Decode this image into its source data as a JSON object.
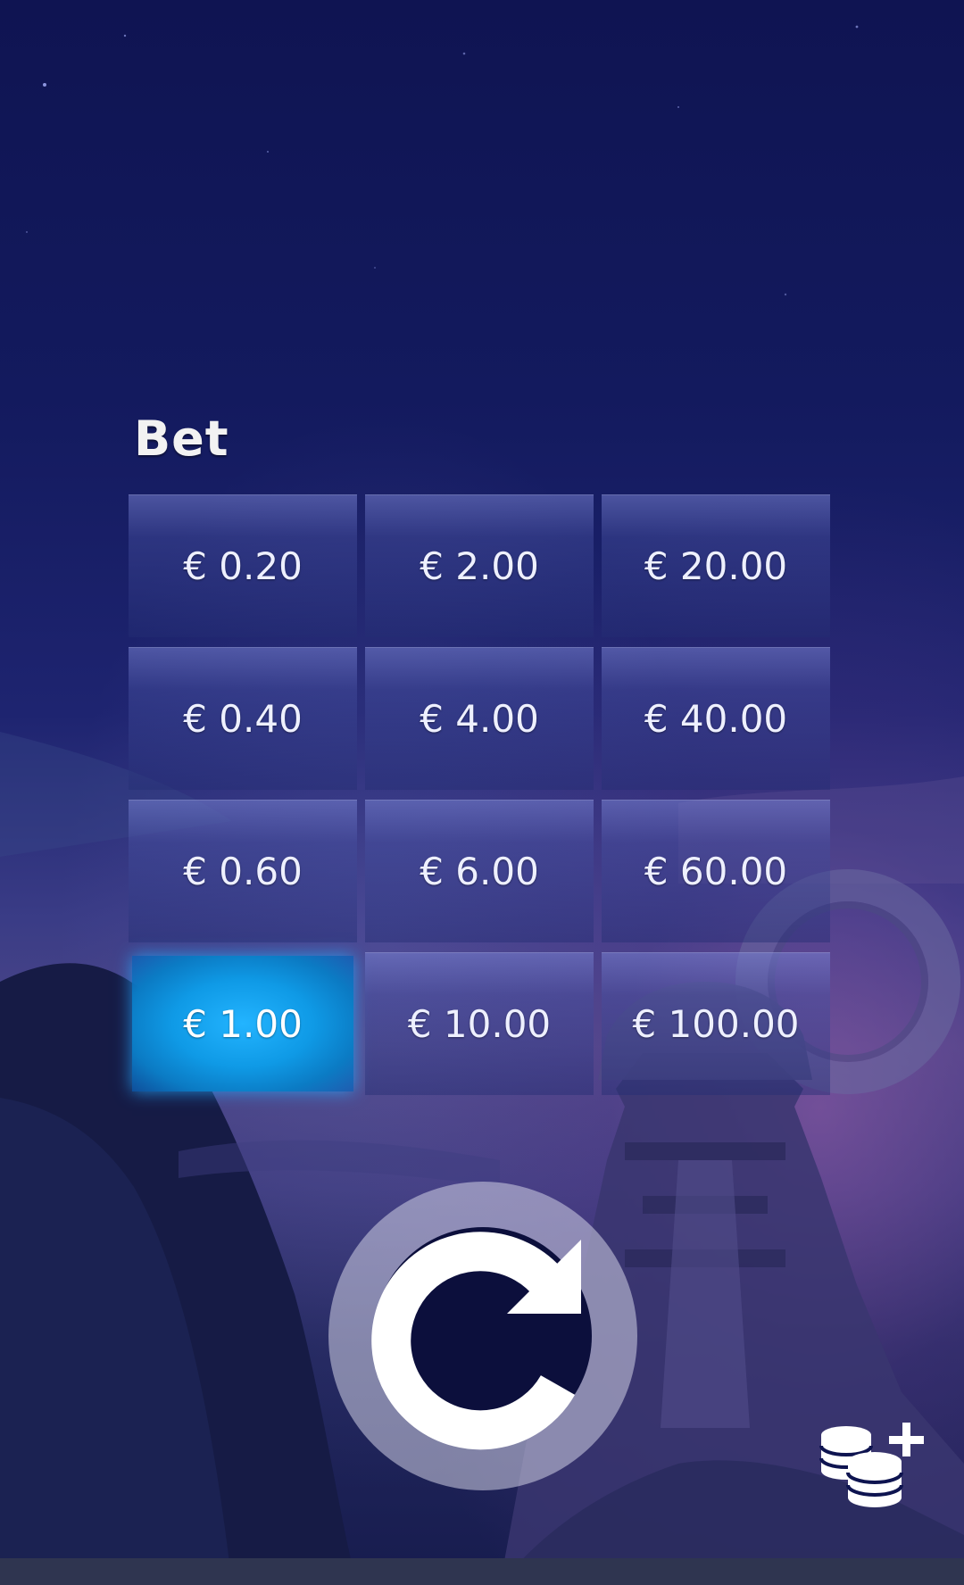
{
  "bet_panel": {
    "heading": "Bet",
    "options": [
      "€ 0.20",
      "€ 2.00",
      "€ 20.00",
      "€ 0.40",
      "€ 4.00",
      "€ 40.00",
      "€ 0.60",
      "€ 6.00",
      "€ 60.00",
      "€ 1.00",
      "€ 10.00",
      "€ 100.00"
    ],
    "selected": "€ 1.00"
  },
  "controls": {
    "spin_icon": "refresh-icon",
    "coins_icon": "coins-plus-icon"
  },
  "colors": {
    "selected_bet": "#139fee",
    "background": "#131a5e"
  }
}
